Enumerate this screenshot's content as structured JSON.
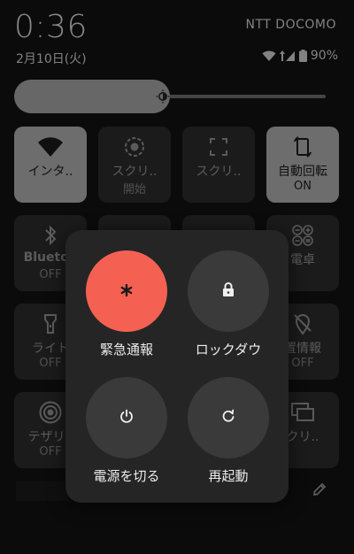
{
  "status_bar": {
    "time": "0:36",
    "date": "2月10日(火)",
    "carrier": "NTT DOCOMO",
    "battery": "90%",
    "icons": [
      "wifi-icon",
      "signal-icon",
      "battery-icon"
    ]
  },
  "brightness": {
    "level": 0.44,
    "icon": "brightness-icon"
  },
  "tiles": [
    {
      "icon": "wifi-icon",
      "label": "インタ..",
      "sub": "",
      "on": true
    },
    {
      "icon": "screen-record-icon",
      "label": "スクリ..",
      "sub": "開始",
      "on": false
    },
    {
      "icon": "screenshot-icon",
      "label": "スクリ..",
      "sub": "",
      "on": false
    },
    {
      "icon": "auto-rotate-icon",
      "label": "自動回転",
      "sub": "ON",
      "on": true
    },
    {
      "icon": "bluetooth-icon",
      "label": "Bluetoo",
      "sub": "OFF",
      "on": false
    },
    {
      "icon": "calculator-icon",
      "label": "電卓",
      "sub": "",
      "on": false
    },
    {
      "icon": "flashlight-icon",
      "label": "ライト",
      "sub": "OFF",
      "on": false
    },
    {
      "icon": "location-off-icon",
      "label": "置情報",
      "sub": "OFF",
      "on": false
    },
    {
      "icon": "hotspot-icon",
      "label": "テザリ..",
      "sub": "OFF",
      "on": false
    },
    {
      "icon": "cast-icon",
      "label": "クリ..",
      "sub": "",
      "on": false
    }
  ],
  "power_menu": {
    "emergency": {
      "label": "緊急通報",
      "icon": "asterisk-icon",
      "color": "#f46152"
    },
    "lockdown": {
      "label": "ロックダウ",
      "icon": "lock-icon"
    },
    "power_off": {
      "label": "電源を切る",
      "icon": "power-icon"
    },
    "restart": {
      "label": "再起動",
      "icon": "restart-icon"
    }
  }
}
